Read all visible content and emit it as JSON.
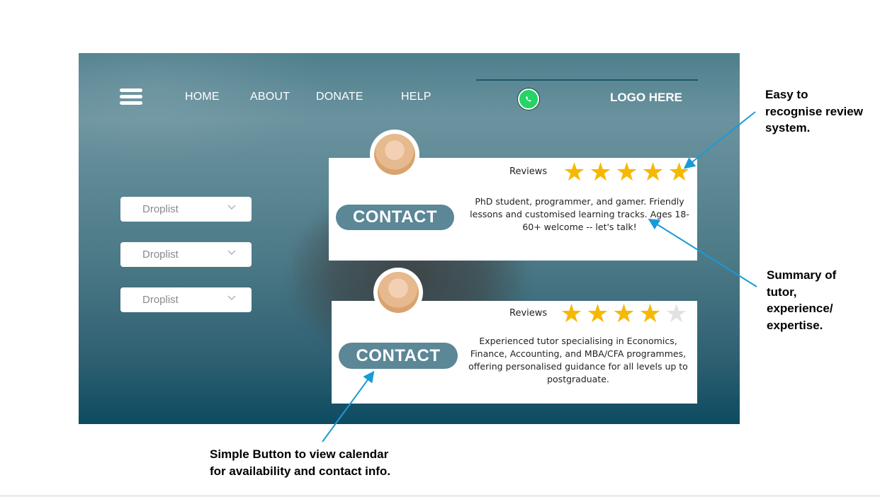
{
  "nav": {
    "menu_icon": "hamburger-menu-icon",
    "links": [
      "HOME",
      "ABOUT",
      "DONATE",
      "HELP"
    ],
    "whatsapp_icon": "whatsapp-icon",
    "logo": "LOGO HERE"
  },
  "filters": [
    "Droplist",
    "Droplist",
    "Droplist"
  ],
  "tutors": [
    {
      "reviews_label": "Reviews",
      "rating": 5,
      "max_rating": 5,
      "contact_label": "CONTACT",
      "summary": "PhD student, programmer, and gamer. Friendly lessons and customised learning tracks. Ages 18-60+ welcome -- let's talk!"
    },
    {
      "reviews_label": "Reviews",
      "rating": 4,
      "max_rating": 5,
      "contact_label": "CONTACT",
      "summary": "Experienced tutor specialising in Economics, Finance, Accounting, and MBA/CFA programmes, offering personalised guidance for all levels up to postgraduate."
    }
  ],
  "annotations": {
    "reviews": "Easy to recognise review system.",
    "summary": "Summary of tutor, experience/ expertise.",
    "button": "Simple Button to view calendar for availability and contact info."
  },
  "colors": {
    "star": "#f6b800",
    "star_empty": "#e2e2e2",
    "button": "#5b8797",
    "arrow": "#1a9ad6"
  }
}
